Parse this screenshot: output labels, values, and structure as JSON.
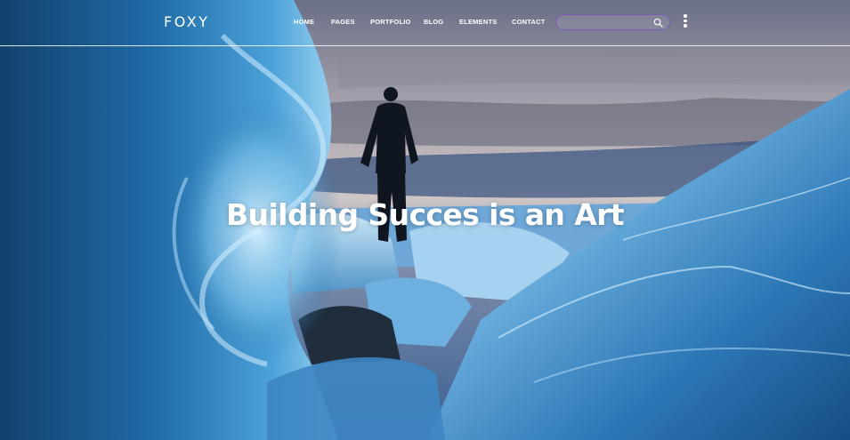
{
  "brand": {
    "logo_text": "FOXY"
  },
  "nav": {
    "items": [
      "HOME",
      "PAGES",
      "PORTFOLIO",
      "BLOG",
      "ELEMENTS",
      "CONTACT"
    ]
  },
  "search": {
    "value": "",
    "placeholder": ""
  },
  "hero": {
    "headline": "Building Succes is an Art",
    "image": "man-standing-on-glacier-ice"
  },
  "icons": {
    "search": "search-icon",
    "more": "kebab-menu-icon"
  },
  "colors": {
    "accent_border": "#7d5bb5",
    "text": "#ffffff",
    "ice": "#2f7fbf"
  }
}
